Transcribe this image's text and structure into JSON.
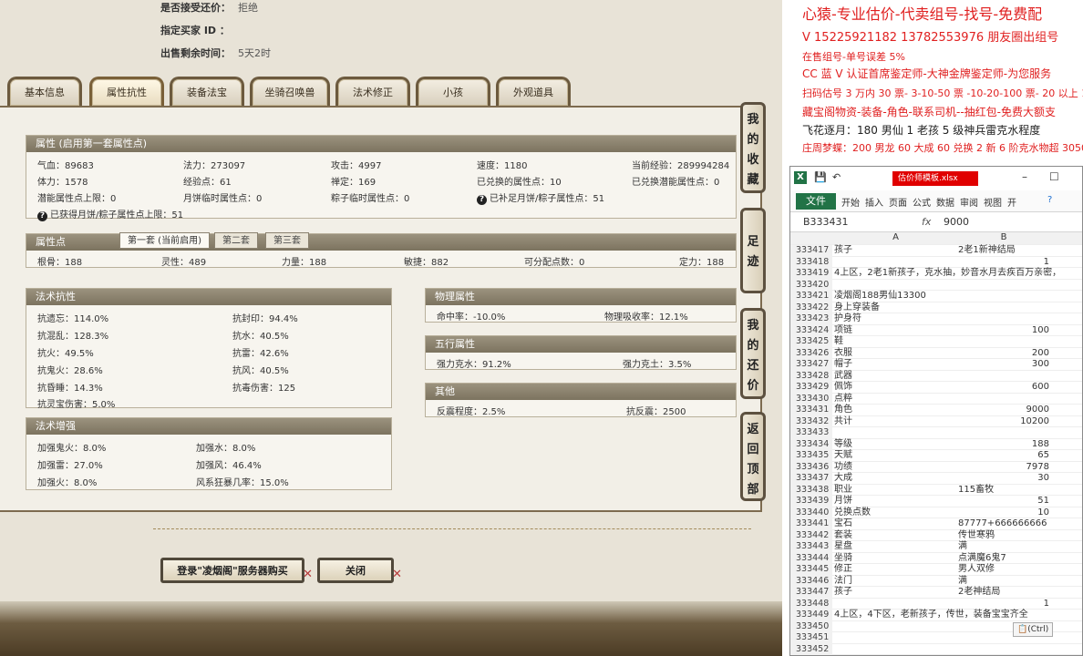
{
  "game": {
    "top_info": [
      {
        "label": "是否接受还价：",
        "value": "拒绝"
      },
      {
        "label": "指定买家 ID ：",
        "value": ""
      },
      {
        "label": "出售剩余时间：",
        "value": "5天2时"
      }
    ],
    "tabs": [
      "基本信息",
      "属性抗性",
      "装备法宝",
      "坐骑召唤兽",
      "法术修正",
      "小孩",
      "外观道具"
    ],
    "attr": {
      "title": "属性 (启用第一套属性点)",
      "rows": [
        [
          "气血：89683",
          "法力：273097",
          "攻击：4997",
          "速度：1180",
          "当前经验：289994284"
        ],
        [
          "体力：1578",
          "经验点：61",
          "禅定：169",
          "已兑换的属性点：10",
          "已兑换潜能属性点：0"
        ],
        [
          "潜能属性点上限：0",
          "月饼临时属性点：0",
          "粽子临时属性点：0",
          "已补足月饼/粽子属性点：51",
          ""
        ]
      ],
      "last": "已获得月饼/粽子属性点上限：51"
    },
    "points": {
      "title": "属性点",
      "subtabs": [
        "第一套 (当前启用)",
        "第二套",
        "第三套"
      ],
      "values": [
        "根骨：188",
        "灵性：489",
        "力量：188",
        "敏捷：882",
        "可分配点数：0",
        "定力：188"
      ]
    },
    "resist": {
      "title": "法术抗性",
      "left": [
        "抗遗忘：114.0%",
        "抗混乱：128.3%",
        "抗火：49.5%",
        "抗鬼火：28.6%",
        "抗昏睡：14.3%",
        "抗灵宝伤害：5.0%"
      ],
      "right": [
        "抗封印：94.4%",
        "抗水：40.5%",
        "抗雷：42.6%",
        "抗风：40.5%",
        "抗毒伤害：125"
      ]
    },
    "boost": {
      "title": "法术增强",
      "left": [
        "加强鬼火：8.0%",
        "加强雷：27.0%",
        "加强火：8.0%"
      ],
      "right": [
        "加强水：8.0%",
        "加强风：46.4%",
        "风系狂暴几率：15.0%"
      ]
    },
    "physical": {
      "title": "物理属性",
      "left": "命中率：-10.0%",
      "right": "物理吸收率：12.1%"
    },
    "wuxing": {
      "title": "五行属性",
      "left": "强力克水：91.2%",
      "right": "强力克土：3.5%"
    },
    "other": {
      "title": "其他",
      "left": "反震程度：2.5%",
      "right": "抗反震：2500"
    },
    "side_buttons": [
      "我的收藏",
      "足迹",
      "我的还价",
      "返回顶部"
    ],
    "buy_button": "登录\"凌烟阁\"服务器购买",
    "close_button": "关闭"
  },
  "notes": {
    "lines": [
      {
        "text": "心猿-专业估价-代卖组号-找号-免费配",
        "color": "#e02020"
      },
      {
        "text": "V 15225921182   13782553976 朋友圈出组号",
        "color": "#e02020"
      },
      {
        "text": "在售组号-单号误差 5%",
        "color": "#e02020"
      },
      {
        "text": "CC 蓝 V 认证首席鉴定师-大神金牌鉴定师-为您服务",
        "color": "#e02020"
      },
      {
        "text": "扫码估号 3 万内 30 票- 3-10-50 票  -10-20-100 票- 20 以上 150",
        "color": "#e02020"
      },
      {
        "text": "藏宝阁物资-装备-角色-联系司机--抽红包-免费大额支",
        "color": "#e02020"
      },
      {
        "text": "飞花逐月：180 男仙 1 老孩 5 级神兵雷克水程度",
        "color": "#222222"
      },
      {
        "text": "庄周梦蝶：200 男龙 60 大成 60 兑换 2 新 6 阶克水物超 30500",
        "color": "#e02020"
      }
    ]
  },
  "excel": {
    "title": "估价师模板.xlsx",
    "ribbon_tabs": [
      "文件",
      "开始",
      "插入",
      "页面",
      "公式",
      "数据",
      "审阅",
      "视图",
      "开"
    ],
    "cell_ref": "B333431",
    "fx": "fx",
    "formula": "9000",
    "col_a": "A",
    "col_b": "B",
    "rows": [
      [
        "333417",
        "孩子",
        "2老1新神结局",
        false
      ],
      [
        "333418",
        "",
        "1",
        true
      ],
      [
        "333419",
        "4上区，2老1新孩子，克水抽，妙音水月去疾百万亲密，",
        "",
        false
      ],
      [
        "333420",
        "",
        "",
        false
      ],
      [
        "333421",
        "凌烟阁188男仙13300",
        "",
        false
      ],
      [
        "333422",
        "身上穿装备",
        "",
        false
      ],
      [
        "333423",
        "护身符",
        "",
        false
      ],
      [
        "333424",
        "项链",
        "100",
        true
      ],
      [
        "333425",
        "鞋",
        "",
        false
      ],
      [
        "333426",
        "衣服",
        "200",
        true
      ],
      [
        "333427",
        "帽子",
        "300",
        true
      ],
      [
        "333428",
        "武器",
        "",
        false
      ],
      [
        "333429",
        "佩饰",
        "600",
        true
      ],
      [
        "333430",
        "点粹",
        "",
        false
      ],
      [
        "333431",
        "角色",
        "9000",
        true
      ],
      [
        "333432",
        "共计",
        "10200",
        true
      ],
      [
        "333433",
        "",
        "",
        false
      ],
      [
        "333434",
        "等级",
        "188",
        true
      ],
      [
        "333435",
        "天赋",
        "65",
        true
      ],
      [
        "333436",
        "功绩",
        "7978",
        true
      ],
      [
        "333437",
        "大成",
        "30",
        true
      ],
      [
        "333438",
        "职业",
        "115畜牧",
        false
      ],
      [
        "333439",
        "月饼",
        "51",
        true
      ],
      [
        "333440",
        "兑换点数",
        "10",
        true
      ],
      [
        "333441",
        "宝石",
        "87777+666666666",
        false
      ],
      [
        "333442",
        "套装",
        "传世寒鸦",
        false
      ],
      [
        "333443",
        "星盘",
        "满",
        false
      ],
      [
        "333444",
        "坐骑",
        "点满魔6鬼7",
        false
      ],
      [
        "333445",
        "修正",
        "男人双修",
        false
      ],
      [
        "333446",
        "法门",
        "满",
        false
      ],
      [
        "333447",
        "孩子",
        "2老神结局",
        false
      ],
      [
        "333448",
        "",
        "1",
        true
      ],
      [
        "333449",
        "4上区，4下区，老新孩子，传世，装备宝宝齐全",
        "",
        false
      ],
      [
        "333450",
        "",
        "",
        false
      ],
      [
        "333451",
        "",
        "",
        false
      ],
      [
        "333452",
        "",
        "",
        false
      ]
    ],
    "paste_hint": "(Ctrl)"
  }
}
